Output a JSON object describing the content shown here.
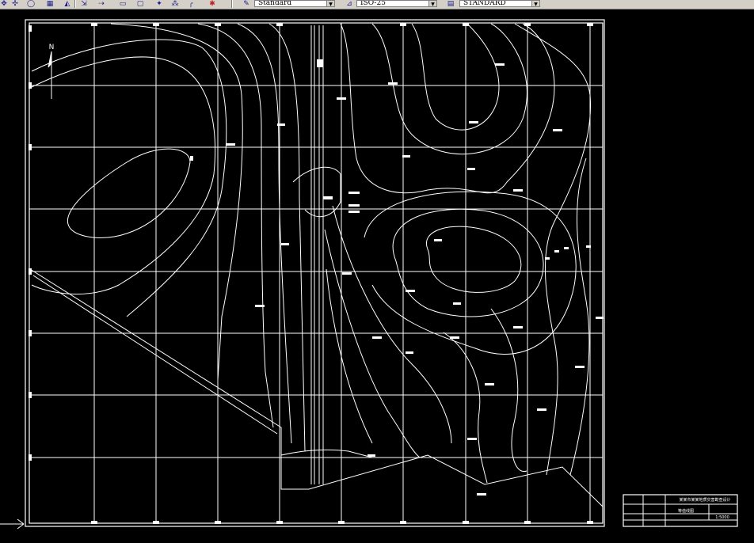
{
  "toolbar": {
    "icons": [
      "pan-icon",
      "zoom-realtime-icon",
      "zoom-window-icon",
      "zoom-previous-icon",
      "properties-icon",
      "match-properties-icon",
      "move-icon",
      "copy-icon",
      "mirror-icon",
      "rotate-icon",
      "explode-icon",
      "dimension-icon",
      "undo-icon",
      "redo-icon"
    ],
    "text_style": "Standard",
    "dim_style": "ISO-25",
    "table_style": "STANDARD"
  },
  "drawing": {
    "north_label": "N",
    "title_block": {
      "project_title": "某某市某某地质灾害勘查设计",
      "drawing_name": "等值线图",
      "scale": "1:5000"
    }
  },
  "colors": {
    "drawing_lines": "#ffffff",
    "canvas_background": "#000000",
    "toolbar_background": "#d4d0c8"
  }
}
